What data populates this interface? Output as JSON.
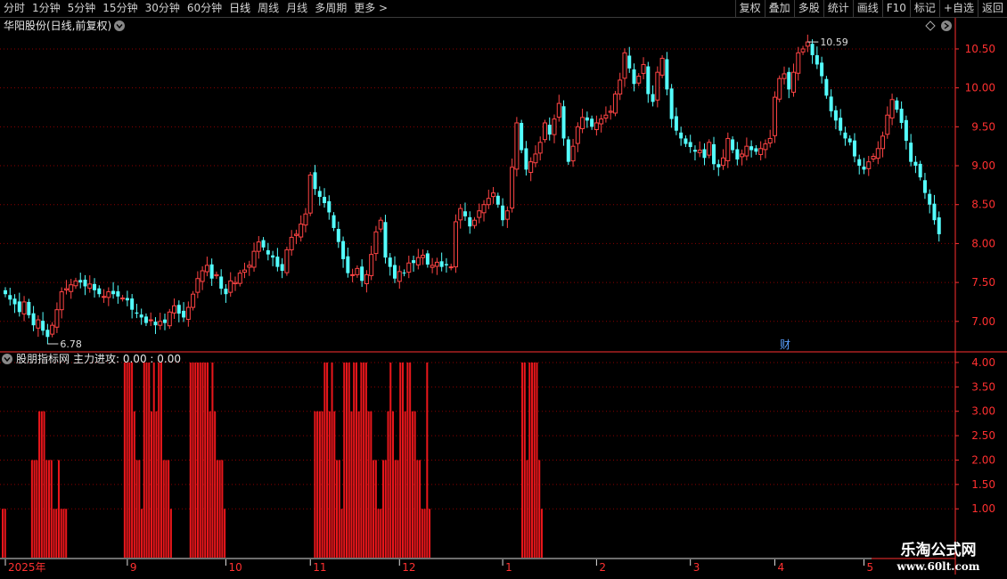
{
  "toolbar": {
    "left_items": [
      "分时",
      "1分钟",
      "5分钟",
      "15分钟",
      "30分钟",
      "60分钟",
      "日线",
      "周线",
      "月线",
      "多周期",
      "更多 >"
    ],
    "active_item": "日线",
    "right_items": [
      "复权",
      "叠加",
      "多股",
      "统计",
      "画线",
      "F10",
      "标记",
      "+自选",
      "返回"
    ]
  },
  "main_panel": {
    "title": "华阳股份(日线,前复权)",
    "high_label": "10.59",
    "low_label": "6.78",
    "finance_marker": "财"
  },
  "indicator_panel": {
    "title": "股朋指标网",
    "legend": "主力进攻: 0.00 : 0.00"
  },
  "x_axis": {
    "labels": [
      "2025年",
      "9",
      "10",
      "11",
      "12",
      "1",
      "2",
      "3",
      "4",
      "5"
    ]
  },
  "watermark": {
    "logo": "乐淘公式网",
    "url": "www.60lt.com"
  },
  "colors": {
    "up": "#ff4444",
    "down": "#54ffff",
    "grid": "#8b0000",
    "bar": "#e8161b",
    "axis": "#ff3030"
  },
  "chart_data": [
    {
      "type": "candlestick",
      "title": "华阳股份(日线,前复权)",
      "y_ticks": [
        7.0,
        7.5,
        8.0,
        8.5,
        9.0,
        9.5,
        10.0,
        10.5
      ],
      "ylim": [
        6.62,
        10.9
      ],
      "high": 10.59,
      "low": 6.78,
      "close_series": [
        7.35,
        7.28,
        7.22,
        7.12,
        7.25,
        7.08,
        6.95,
        7.02,
        6.88,
        6.8,
        6.95,
        7.15,
        7.38,
        7.42,
        7.47,
        7.52,
        7.5,
        7.45,
        7.48,
        7.4,
        7.35,
        7.32,
        7.38,
        7.35,
        7.32,
        7.3,
        7.27,
        7.15,
        7.1,
        7.05,
        6.98,
        7.02,
        6.95,
        7.0,
        6.98,
        7.12,
        7.2,
        7.1,
        7.05,
        7.18,
        7.35,
        7.55,
        7.65,
        7.72,
        7.55,
        7.6,
        7.42,
        7.35,
        7.52,
        7.5,
        7.62,
        7.66,
        7.72,
        7.9,
        8.02,
        7.95,
        7.86,
        7.82,
        7.7,
        7.65,
        7.92,
        8.08,
        8.12,
        8.25,
        8.38,
        8.88,
        8.7,
        8.6,
        8.52,
        8.4,
        8.2,
        8.02,
        7.8,
        7.62,
        7.6,
        7.68,
        7.52,
        7.6,
        7.86,
        8.15,
        8.3,
        7.82,
        7.7,
        7.55,
        7.64,
        7.62,
        7.75,
        7.75,
        7.82,
        7.85,
        7.73,
        7.72,
        7.76,
        7.7,
        7.72,
        7.7,
        8.28,
        8.45,
        8.35,
        8.22,
        8.3,
        8.42,
        8.5,
        8.58,
        8.65,
        8.5,
        8.3,
        8.42,
        8.98,
        9.55,
        9.2,
        8.95,
        9.05,
        9.15,
        9.3,
        9.55,
        9.4,
        9.6,
        9.8,
        9.35,
        9.05,
        9.25,
        9.5,
        9.62,
        9.58,
        9.5,
        9.55,
        9.6,
        9.65,
        9.7,
        9.92,
        10.1,
        10.45,
        10.25,
        10.05,
        10.15,
        10.3,
        9.92,
        9.82,
        10.2,
        10.38,
        9.98,
        9.6,
        9.45,
        9.35,
        9.28,
        9.24,
        9.18,
        9.2,
        9.1,
        9.3,
        9.02,
        8.98,
        9.1,
        9.35,
        9.2,
        9.08,
        9.15,
        9.25,
        9.2,
        9.18,
        9.22,
        9.28,
        9.35,
        9.88,
        10.12,
        10.18,
        9.98,
        10.2,
        10.45,
        10.5,
        10.59,
        10.42,
        10.3,
        10.15,
        9.9,
        9.7,
        9.58,
        9.45,
        9.35,
        9.3,
        9.12,
        9.0,
        8.95,
        9.05,
        9.12,
        9.22,
        9.38,
        9.65,
        9.85,
        9.72,
        9.55,
        9.32,
        9.05,
        9.0,
        8.85,
        8.65,
        8.5,
        8.3,
        8.12
      ]
    },
    {
      "type": "bar",
      "title": "股朋指标网",
      "series_name": "主力进攻",
      "y_ticks": [
        1.0,
        1.5,
        2.0,
        2.5,
        3.0,
        3.5,
        4.0
      ],
      "ylim": [
        0,
        4.2
      ],
      "values": [
        1,
        1,
        0,
        0,
        0,
        0,
        0,
        0,
        0,
        0,
        0,
        0,
        2,
        2,
        2,
        3,
        3,
        3,
        2,
        2,
        2,
        1,
        1,
        2,
        1,
        1,
        1,
        0,
        0,
        0,
        0,
        0,
        0,
        0,
        0,
        0,
        0,
        0,
        0,
        0,
        0,
        0,
        0,
        0,
        0,
        0,
        0,
        0,
        0,
        0,
        4,
        4,
        4,
        4,
        3,
        2,
        2,
        1,
        4,
        4,
        4,
        3,
        4,
        3,
        4,
        4,
        2,
        2,
        2,
        1,
        0,
        0,
        0,
        0,
        0,
        0,
        0,
        4,
        4,
        4,
        4,
        4,
        4,
        4,
        4,
        3,
        4,
        3,
        2,
        2,
        2,
        1,
        0,
        0,
        0,
        0,
        0,
        0,
        0,
        0,
        0,
        0,
        0,
        0,
        0,
        0,
        0,
        0,
        0,
        0,
        0,
        0,
        0,
        0,
        0,
        0,
        0,
        0,
        0,
        0,
        0,
        0,
        0,
        0,
        0,
        0,
        0,
        0,
        3,
        3,
        3,
        3,
        4,
        4,
        3,
        4,
        3,
        2,
        2,
        1,
        4,
        4,
        4,
        3,
        4,
        4,
        3,
        4,
        4,
        4,
        3,
        3,
        2,
        2,
        1,
        1,
        2,
        2,
        3,
        4,
        3,
        2,
        2,
        4,
        4,
        3,
        4,
        4,
        3,
        3,
        2,
        2,
        1,
        1,
        4,
        1,
        0,
        0,
        0,
        0,
        0,
        0,
        0,
        0,
        0,
        0,
        0,
        0,
        0,
        0,
        0,
        0,
        0,
        0,
        0,
        0,
        0,
        0,
        0,
        0,
        0,
        0,
        0,
        0,
        0,
        0,
        0,
        0,
        0,
        0,
        0,
        0,
        0,
        4,
        4,
        2,
        4,
        4,
        4,
        4,
        2,
        1,
        0,
        0,
        0,
        0,
        0,
        0,
        0,
        0,
        0,
        0,
        0,
        0,
        0,
        0,
        0,
        0,
        0,
        0,
        0,
        0,
        0,
        0,
        0,
        0,
        0,
        0,
        0,
        0,
        0,
        0,
        0,
        0,
        0,
        0,
        0,
        0,
        0,
        0,
        0,
        0,
        0,
        0,
        0,
        0,
        0,
        0,
        0,
        0,
        0,
        0,
        0,
        0,
        0,
        0,
        0,
        0,
        0,
        0,
        0,
        0,
        0,
        0,
        0,
        0,
        0,
        0,
        0,
        0,
        0,
        0,
        0,
        0,
        0,
        0,
        0,
        0,
        0,
        0,
        0,
        0,
        0,
        0,
        0,
        0,
        0,
        0,
        0,
        0,
        0,
        0,
        0,
        0,
        0,
        0,
        0,
        0,
        0,
        0,
        0,
        0,
        0,
        0,
        0,
        0,
        0,
        0,
        0,
        0,
        0,
        0,
        0,
        0,
        0
      ]
    }
  ]
}
